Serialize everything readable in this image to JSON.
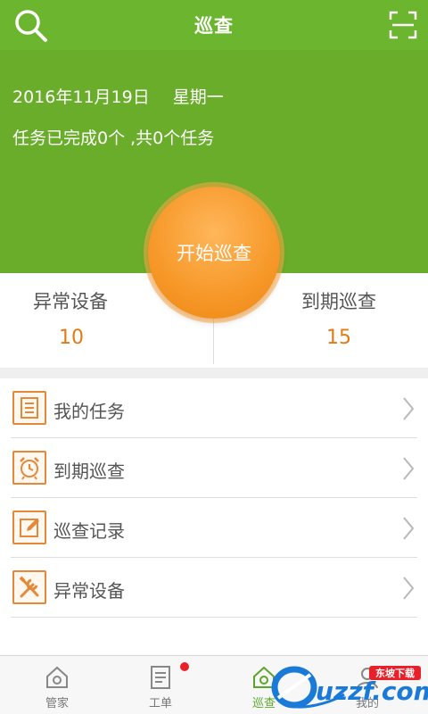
{
  "header": {
    "title": "巡查",
    "search_icon": "search-icon",
    "scan_icon": "scan-icon"
  },
  "summary": {
    "date": "2016年11月19日",
    "weekday": "星期一",
    "task_status": "任务已完成0个 ,共0个任务"
  },
  "start_button": {
    "label": "开始巡查",
    "color": "#f79a2c"
  },
  "stats": [
    {
      "label": "异常设备",
      "value": "10"
    },
    {
      "label": "到期巡查",
      "value": "15"
    }
  ],
  "menu": [
    {
      "label": "我的任务",
      "icon": "document-list-icon"
    },
    {
      "label": "到期巡查",
      "icon": "alarm-clock-icon"
    },
    {
      "label": "巡查记录",
      "icon": "edit-record-icon"
    },
    {
      "label": "异常设备",
      "icon": "tools-icon"
    }
  ],
  "tabs": [
    {
      "label": "管家",
      "icon": "home-icon",
      "active": false
    },
    {
      "label": "工单",
      "icon": "work-order-icon",
      "active": false,
      "badge": true
    },
    {
      "label": "巡查",
      "icon": "patrol-icon",
      "active": true
    },
    {
      "label": "我的",
      "icon": "profile-icon",
      "active": false
    }
  ],
  "watermark": {
    "text": "uzzf.com",
    "tag": "东坡下载"
  },
  "colors": {
    "header_green": "#6cb52e",
    "panel_green": "#69ad2a",
    "accent_orange": "#e07b16",
    "icon_orange": "#e4893a"
  }
}
